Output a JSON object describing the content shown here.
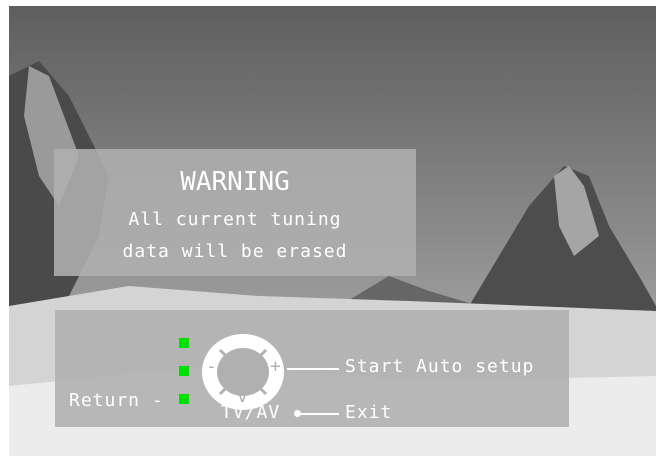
{
  "warning": {
    "title": "WARNING",
    "line1": "All current tuning",
    "line2": "data will be erased"
  },
  "controls": {
    "return_label": "Return -",
    "start_label": "Start Auto setup",
    "tvav_label": "TV/AV",
    "exit_label": "Exit",
    "remote_up": "^",
    "remote_down": "v",
    "remote_minus": "-",
    "remote_plus": "+",
    "indicator_color": "#00e000"
  }
}
